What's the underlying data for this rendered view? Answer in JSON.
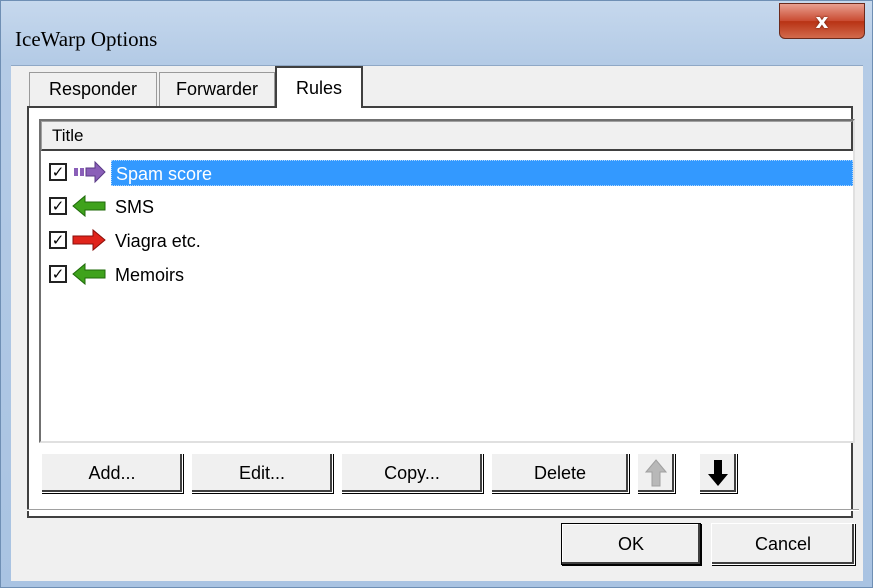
{
  "window": {
    "title": "IceWarp Options",
    "close_label": "x"
  },
  "tabs": [
    {
      "label": "Responder",
      "active": false
    },
    {
      "label": "Forwarder",
      "active": false
    },
    {
      "label": "Rules",
      "active": true
    }
  ],
  "list": {
    "column_header": "Title",
    "rows": [
      {
        "label": "Spam score",
        "checked": true,
        "icon": "purple-right-arrow-icon",
        "selected": true
      },
      {
        "label": "SMS",
        "checked": true,
        "icon": "green-left-arrow-icon",
        "selected": false
      },
      {
        "label": "Viagra etc.",
        "checked": true,
        "icon": "red-right-arrow-icon",
        "selected": false
      },
      {
        "label": "Memoirs",
        "checked": true,
        "icon": "green-left-arrow-icon",
        "selected": false
      }
    ]
  },
  "actions": {
    "add_label": "Add...",
    "edit_label": "Edit...",
    "copy_label": "Copy...",
    "delete_label": "Delete",
    "move_up_icon": "up-arrow-icon",
    "move_down_icon": "down-arrow-icon"
  },
  "dialog": {
    "ok_label": "OK",
    "cancel_label": "Cancel"
  },
  "colors": {
    "selection": "#3399ff",
    "purple_arrow": "#8a5fb8",
    "green_arrow": "#3fa21c",
    "red_arrow": "#e0241b"
  }
}
